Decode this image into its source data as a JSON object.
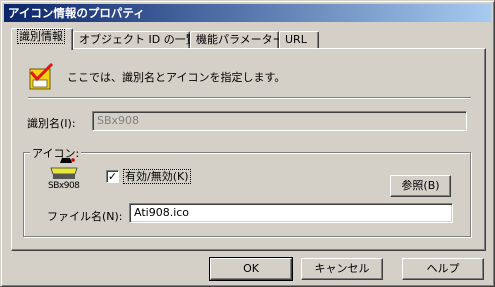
{
  "window": {
    "title": "アイコン情報のプロパティ"
  },
  "tabs": [
    {
      "label": "識別情報"
    },
    {
      "label": "オブジェクト ID の一覧"
    },
    {
      "label": "機能パラメーター"
    },
    {
      "label": "URL"
    }
  ],
  "info": {
    "text": "ここでは、識別名とアイコンを指定します。",
    "icon": "checkmark-clipboard-icon"
  },
  "identifier": {
    "label": "識別名(I):",
    "value": "SBx908"
  },
  "icon_group": {
    "legend": "アイコン:",
    "device_caption": "SBx908",
    "device_icon": "network-switch-icon",
    "enable_label": "有効/無効(K)",
    "enable_checked": true,
    "browse_label": "参照(B)",
    "file_label": "ファイル名(N):",
    "file_value": "Ati908.ico"
  },
  "buttons": {
    "ok": "OK",
    "cancel": "キャンセル",
    "help": "ヘルプ"
  }
}
